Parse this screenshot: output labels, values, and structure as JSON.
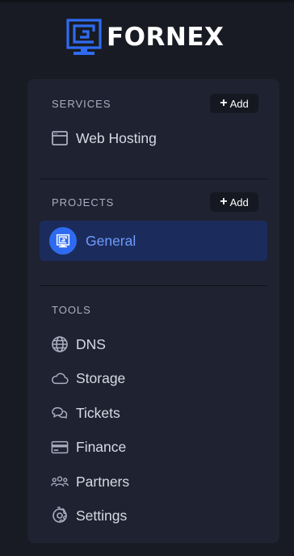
{
  "brand": {
    "name": "FORNEX",
    "accent": "#2f6bf0"
  },
  "services": {
    "heading": "SERVICES",
    "add_label": "Add",
    "items": [
      {
        "label": "Web Hosting",
        "icon": "browser-window-icon"
      }
    ]
  },
  "projects": {
    "heading": "PROJECTS",
    "add_label": "Add",
    "items": [
      {
        "label": "General",
        "icon": "fornex-logo-icon",
        "active": true
      }
    ]
  },
  "tools": {
    "heading": "TOOLS",
    "items": [
      {
        "label": "DNS",
        "icon": "globe-icon"
      },
      {
        "label": "Storage",
        "icon": "cloud-icon"
      },
      {
        "label": "Tickets",
        "icon": "chat-bubbles-icon"
      },
      {
        "label": "Finance",
        "icon": "credit-card-icon"
      },
      {
        "label": "Partners",
        "icon": "users-icon"
      },
      {
        "label": "Settings",
        "icon": "gear-icon"
      }
    ]
  }
}
